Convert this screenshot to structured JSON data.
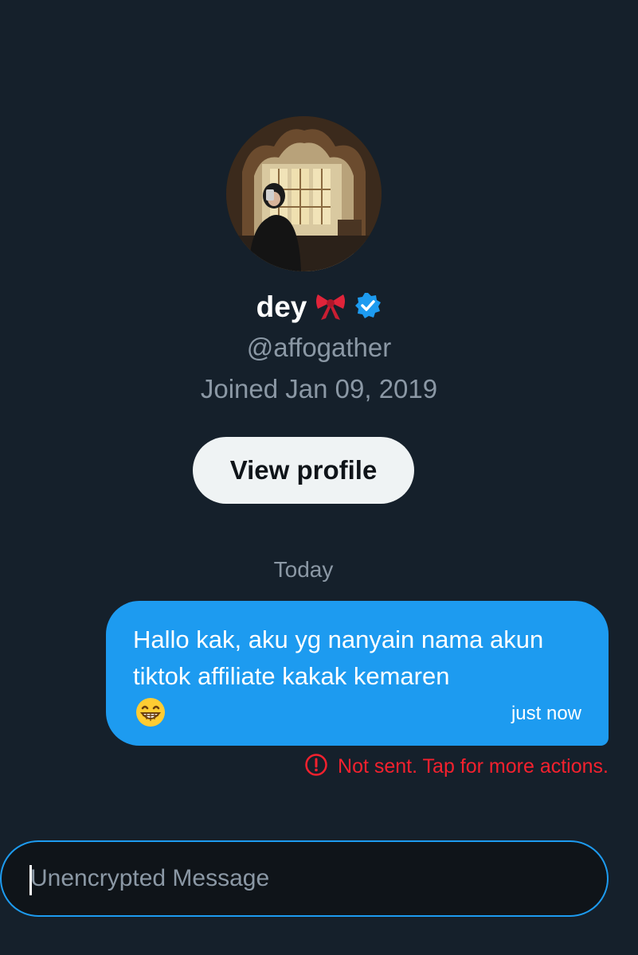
{
  "colors": {
    "background": "#15202b",
    "accent": "#1d9bf0",
    "muted_text": "#8b98a5",
    "error": "#f4212e",
    "button_bg": "#eff3f4"
  },
  "profile": {
    "avatar_icon": "profile-photo",
    "display_name": "dey",
    "name_emoji_icon": "ribbon-bow-icon",
    "verified_icon": "verified-badge-icon",
    "handle": "@affogather",
    "joined": "Joined Jan 09, 2019",
    "view_profile_label": "View profile"
  },
  "conversation": {
    "date_divider": "Today",
    "messages": [
      {
        "text": "Hallo kak, aku yg nanyain nama akun tiktok affiliate kakak kemaren",
        "emoji_icon": "grinning-face-icon",
        "timestamp": "just now",
        "status_icon": "alert-circle-icon",
        "status_text": "Not sent. Tap for more actions."
      }
    ]
  },
  "composer": {
    "placeholder": "Unencrypted Message",
    "value": ""
  }
}
